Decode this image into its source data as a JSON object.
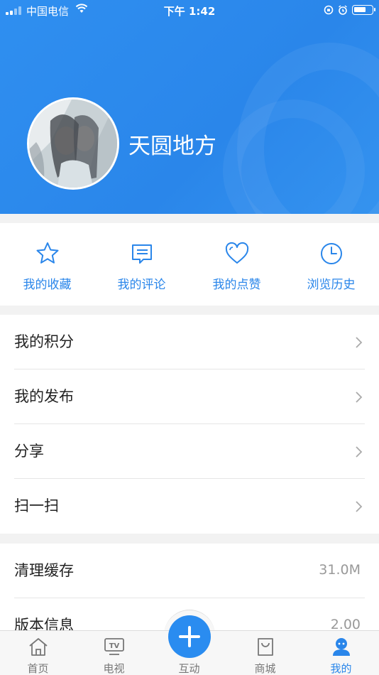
{
  "status_bar": {
    "carrier": "中国电信",
    "time": "下午 1:42"
  },
  "profile": {
    "username": "天圆地方"
  },
  "quick_actions": [
    {
      "label": "我的收藏",
      "icon": "star-icon"
    },
    {
      "label": "我的评论",
      "icon": "comment-icon"
    },
    {
      "label": "我的点赞",
      "icon": "heart-icon"
    },
    {
      "label": "浏览历史",
      "icon": "clock-icon"
    }
  ],
  "menu": {
    "group1": [
      {
        "label": "我的积分"
      },
      {
        "label": "我的发布"
      },
      {
        "label": "分享"
      },
      {
        "label": "扫一扫"
      }
    ],
    "group2": [
      {
        "label": "清理缓存",
        "value": "31.0M"
      },
      {
        "label": "版本信息",
        "value": "2.00"
      }
    ]
  },
  "tabbar": {
    "tabs": [
      {
        "label": "首页"
      },
      {
        "label": "电视"
      },
      {
        "label": "互动"
      },
      {
        "label": "商城"
      },
      {
        "label": "我的"
      }
    ],
    "active": "我的",
    "tv_badge": "TV"
  },
  "colors": {
    "accent": "#2a86ea",
    "header_bg": "#2f8ff0"
  }
}
